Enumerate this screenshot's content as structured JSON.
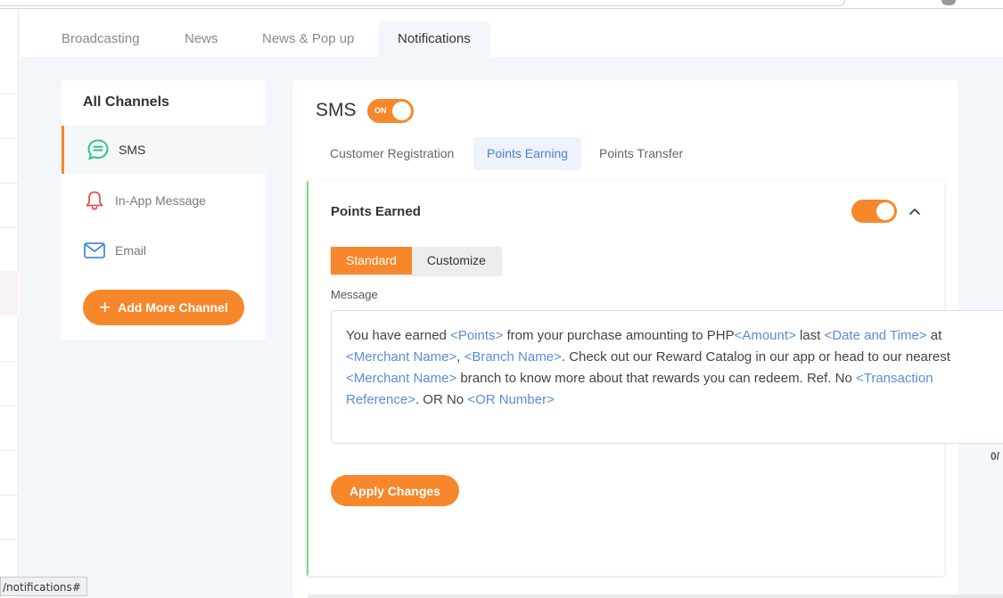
{
  "tabs": [
    {
      "label": "Broadcasting"
    },
    {
      "label": "News"
    },
    {
      "label": "News & Pop up"
    },
    {
      "label": "Notifications",
      "active": true
    }
  ],
  "sidebar": {
    "title": "All Channels",
    "items": [
      {
        "label": "SMS",
        "icon": "sms-chat-icon",
        "active": true
      },
      {
        "label": "In-App Message",
        "icon": "bell-icon"
      },
      {
        "label": "Email",
        "icon": "envelope-icon"
      }
    ],
    "add_button": "Add More Channel"
  },
  "panel": {
    "title": "SMS",
    "toggle_label": "ON",
    "subtabs": [
      {
        "label": "Customer Registration"
      },
      {
        "label": "Points Earning",
        "active": true
      },
      {
        "label": "Points Transfer"
      }
    ],
    "card": {
      "title": "Points Earned",
      "enabled": true,
      "modes": [
        "Standard",
        "Customize"
      ],
      "active_mode": "Standard",
      "message_label": "Message",
      "message": {
        "t1": "You have earned ",
        "tag_points": "<Points>",
        "t2": " from your purchase amounting to PHP",
        "tag_amount": "<Amount>",
        "t3": " last ",
        "tag_datetime": "<Date and Time>",
        "t4": " at",
        "tag_merchant1": "<Merchant Name>",
        "t5": ", ",
        "tag_branch": "<Branch Name>",
        "t6": ". Check out our Reward Catalog in our app or head to our nearest",
        "tag_merchant2": "<Merchant Name>",
        "t7": " branch to know more about that rewards you can redeem. Ref. No ",
        "tag_txn1": "<Transaction",
        "tag_txn2": "Reference>",
        "t8": ". OR No ",
        "tag_or": "<OR Number>"
      },
      "apply_button": "Apply Changes"
    },
    "counter": "0/"
  },
  "status_url": "/notifications#",
  "colors": {
    "accent": "#f7872b",
    "link": "#5a8be0",
    "active_border": "#7ed87e",
    "tab_active": "#4a7fd8"
  }
}
